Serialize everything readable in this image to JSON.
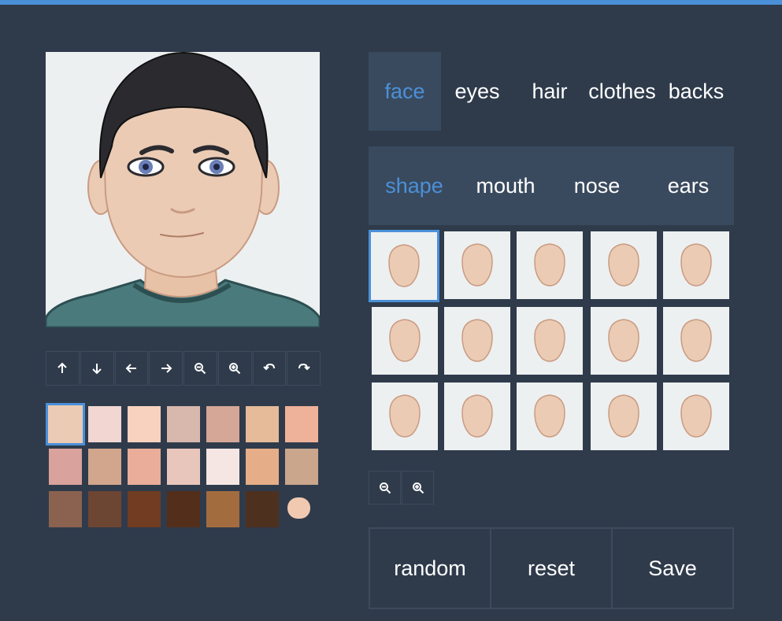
{
  "categories": [
    {
      "label": "face",
      "active": true
    },
    {
      "label": "eyes",
      "active": false
    },
    {
      "label": "hair",
      "active": false
    },
    {
      "label": "clothes",
      "active": false
    },
    {
      "label": "backs",
      "active": false
    }
  ],
  "subcategories": [
    {
      "label": "shape",
      "active": true
    },
    {
      "label": "mouth",
      "active": false
    },
    {
      "label": "nose",
      "active": false
    },
    {
      "label": "ears",
      "active": false
    }
  ],
  "toolbar": {
    "icons": [
      "arrow-up-icon",
      "arrow-down-icon",
      "arrow-left-icon",
      "arrow-right-icon",
      "zoom-out-icon",
      "zoom-in-icon",
      "undo-icon",
      "redo-icon"
    ]
  },
  "skin_colors": [
    "#ebcbb4",
    "#f1d6d1",
    "#f9d2bf",
    "#d8b7ad",
    "#d5a797",
    "#e5bb9a",
    "#eeb29a",
    "#d9a29c",
    "#d2a68c",
    "#e9ad99",
    "#e9c6bb",
    "#f5e6e3",
    "#e6ae88",
    "#c9a68c",
    "#8b6250",
    "#6d4533",
    "#703c22",
    "#532e1b",
    "#a36c3f",
    "#4e301f"
  ],
  "selected_skin_index": 0,
  "custom_color": "#f0c9b0",
  "face_shapes_count": 15,
  "selected_shape_index": 0,
  "actions": {
    "random_label": "random",
    "reset_label": "reset",
    "save_label": "Save"
  },
  "colors": {
    "accent": "#4a90d9",
    "background": "#2f3b4b",
    "panel": "#3a4a5e",
    "tile": "#edf0f1",
    "shirt": "#4b7a7c",
    "hair": "#2b2a2f",
    "skin": "#ebcbb4"
  }
}
